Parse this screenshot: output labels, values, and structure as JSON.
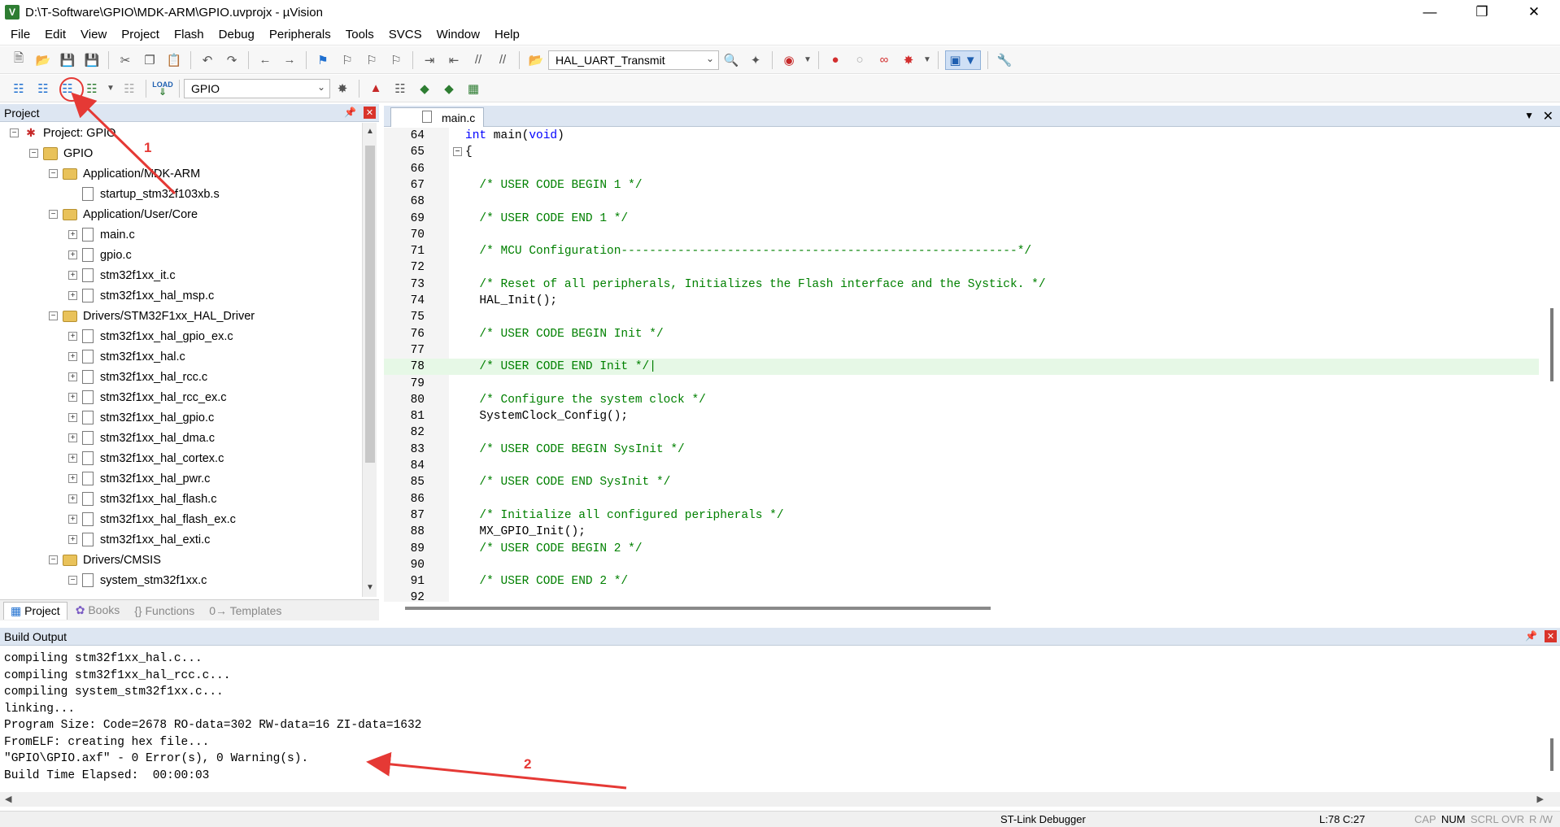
{
  "window": {
    "title": "D:\\T-Software\\GPIO\\MDK-ARM\\GPIO.uvprojx - µVision",
    "app_icon": "V"
  },
  "menu": [
    "File",
    "Edit",
    "View",
    "Project",
    "Flash",
    "Debug",
    "Peripherals",
    "Tools",
    "SVCS",
    "Window",
    "Help"
  ],
  "toolbar1": {
    "find_combo_value": "HAL_UART_Transmit"
  },
  "toolbar2": {
    "target_combo_value": "GPIO",
    "load_label": "LOAD"
  },
  "project_panel": {
    "title": "Project",
    "tree": [
      {
        "label": "Project: GPIO",
        "level": 0,
        "kind": "project",
        "expander": "−"
      },
      {
        "label": "GPIO",
        "level": 1,
        "kind": "target",
        "expander": "−"
      },
      {
        "label": "Application/MDK-ARM",
        "level": 2,
        "kind": "folder",
        "expander": "−"
      },
      {
        "label": "startup_stm32f103xb.s",
        "level": 3,
        "kind": "file",
        "expander": ""
      },
      {
        "label": "Application/User/Core",
        "level": 2,
        "kind": "folder",
        "expander": "−"
      },
      {
        "label": "main.c",
        "level": 3,
        "kind": "file",
        "expander": "+"
      },
      {
        "label": "gpio.c",
        "level": 3,
        "kind": "file",
        "expander": "+"
      },
      {
        "label": "stm32f1xx_it.c",
        "level": 3,
        "kind": "file",
        "expander": "+"
      },
      {
        "label": "stm32f1xx_hal_msp.c",
        "level": 3,
        "kind": "file",
        "expander": "+"
      },
      {
        "label": "Drivers/STM32F1xx_HAL_Driver",
        "level": 2,
        "kind": "folder",
        "expander": "−"
      },
      {
        "label": "stm32f1xx_hal_gpio_ex.c",
        "level": 3,
        "kind": "file",
        "expander": "+"
      },
      {
        "label": "stm32f1xx_hal.c",
        "level": 3,
        "kind": "file",
        "expander": "+"
      },
      {
        "label": "stm32f1xx_hal_rcc.c",
        "level": 3,
        "kind": "file",
        "expander": "+"
      },
      {
        "label": "stm32f1xx_hal_rcc_ex.c",
        "level": 3,
        "kind": "file",
        "expander": "+"
      },
      {
        "label": "stm32f1xx_hal_gpio.c",
        "level": 3,
        "kind": "file",
        "expander": "+"
      },
      {
        "label": "stm32f1xx_hal_dma.c",
        "level": 3,
        "kind": "file",
        "expander": "+"
      },
      {
        "label": "stm32f1xx_hal_cortex.c",
        "level": 3,
        "kind": "file",
        "expander": "+"
      },
      {
        "label": "stm32f1xx_hal_pwr.c",
        "level": 3,
        "kind": "file",
        "expander": "+"
      },
      {
        "label": "stm32f1xx_hal_flash.c",
        "level": 3,
        "kind": "file",
        "expander": "+"
      },
      {
        "label": "stm32f1xx_hal_flash_ex.c",
        "level": 3,
        "kind": "file",
        "expander": "+"
      },
      {
        "label": "stm32f1xx_hal_exti.c",
        "level": 3,
        "kind": "file",
        "expander": "+"
      },
      {
        "label": "Drivers/CMSIS",
        "level": 2,
        "kind": "folder",
        "expander": "−"
      },
      {
        "label": "system_stm32f1xx.c",
        "level": 3,
        "kind": "file",
        "expander": "−"
      }
    ],
    "tabs": [
      "Project",
      "Books",
      "{} Functions",
      "0→ Templates"
    ]
  },
  "editor": {
    "tab_label": "main.c",
    "lines": [
      {
        "n": "64",
        "text": "int main(void)",
        "style": "code",
        "fold": ""
      },
      {
        "n": "65",
        "text": "{",
        "style": "code",
        "fold": "−"
      },
      {
        "n": "66",
        "text": "",
        "style": "code",
        "fold": ""
      },
      {
        "n": "67",
        "text": "  /* USER CODE BEGIN 1 */",
        "style": "comment",
        "fold": ""
      },
      {
        "n": "68",
        "text": "",
        "style": "code",
        "fold": ""
      },
      {
        "n": "69",
        "text": "  /* USER CODE END 1 */",
        "style": "comment",
        "fold": ""
      },
      {
        "n": "70",
        "text": "",
        "style": "code",
        "fold": ""
      },
      {
        "n": "71",
        "text": "  /* MCU Configuration--------------------------------------------------------*/",
        "style": "comment",
        "fold": ""
      },
      {
        "n": "72",
        "text": "",
        "style": "code",
        "fold": ""
      },
      {
        "n": "73",
        "text": "  /* Reset of all peripherals, Initializes the Flash interface and the Systick. */",
        "style": "comment",
        "fold": ""
      },
      {
        "n": "74",
        "text": "  HAL_Init();",
        "style": "code",
        "fold": ""
      },
      {
        "n": "75",
        "text": "",
        "style": "code",
        "fold": ""
      },
      {
        "n": "76",
        "text": "  /* USER CODE BEGIN Init */",
        "style": "comment",
        "fold": ""
      },
      {
        "n": "77",
        "text": "",
        "style": "code",
        "fold": ""
      },
      {
        "n": "78",
        "text": "  /* USER CODE END Init */|",
        "style": "comment",
        "fold": "",
        "current": true
      },
      {
        "n": "79",
        "text": "",
        "style": "code",
        "fold": ""
      },
      {
        "n": "80",
        "text": "  /* Configure the system clock */",
        "style": "comment",
        "fold": ""
      },
      {
        "n": "81",
        "text": "  SystemClock_Config();",
        "style": "code",
        "fold": ""
      },
      {
        "n": "82",
        "text": "",
        "style": "code",
        "fold": ""
      },
      {
        "n": "83",
        "text": "  /* USER CODE BEGIN SysInit */",
        "style": "comment",
        "fold": ""
      },
      {
        "n": "84",
        "text": "",
        "style": "code",
        "fold": ""
      },
      {
        "n": "85",
        "text": "  /* USER CODE END SysInit */",
        "style": "comment",
        "fold": ""
      },
      {
        "n": "86",
        "text": "",
        "style": "code",
        "fold": ""
      },
      {
        "n": "87",
        "text": "  /* Initialize all configured peripherals */",
        "style": "comment",
        "fold": ""
      },
      {
        "n": "88",
        "text": "  MX_GPIO_Init();",
        "style": "code",
        "fold": ""
      },
      {
        "n": "89",
        "text": "  /* USER CODE BEGIN 2 */",
        "style": "comment",
        "fold": ""
      },
      {
        "n": "90",
        "text": "",
        "style": "code",
        "fold": ""
      },
      {
        "n": "91",
        "text": "  /* USER CODE END 2 */",
        "style": "comment",
        "fold": ""
      },
      {
        "n": "92",
        "text": "",
        "style": "code",
        "fold": ""
      }
    ]
  },
  "build_output": {
    "title": "Build Output",
    "lines": [
      "compiling stm32f1xx_hal.c...",
      "compiling stm32f1xx_hal_rcc.c...",
      "compiling system_stm32f1xx.c...",
      "linking...",
      "Program Size: Code=2678 RO-data=302 RW-data=16 ZI-data=1632",
      "FromELF: creating hex file...",
      "\"GPIO\\GPIO.axf\" - 0 Error(s), 0 Warning(s).",
      "Build Time Elapsed:  00:00:03"
    ]
  },
  "statusbar": {
    "debugger": "ST-Link Debugger",
    "cursor": "L:78 C:27",
    "cap": "CAP",
    "num": "NUM",
    "scrl": "SCRL",
    "ovr": "OVR",
    "rw": "R /W"
  },
  "annotations": {
    "label1": "1",
    "label2": "2",
    "color": "#e53935"
  },
  "colors": {
    "keyword": "#0000ff",
    "comment": "#008000",
    "current_line": "#e6f8e6",
    "panel_header": "#dde6f2"
  }
}
